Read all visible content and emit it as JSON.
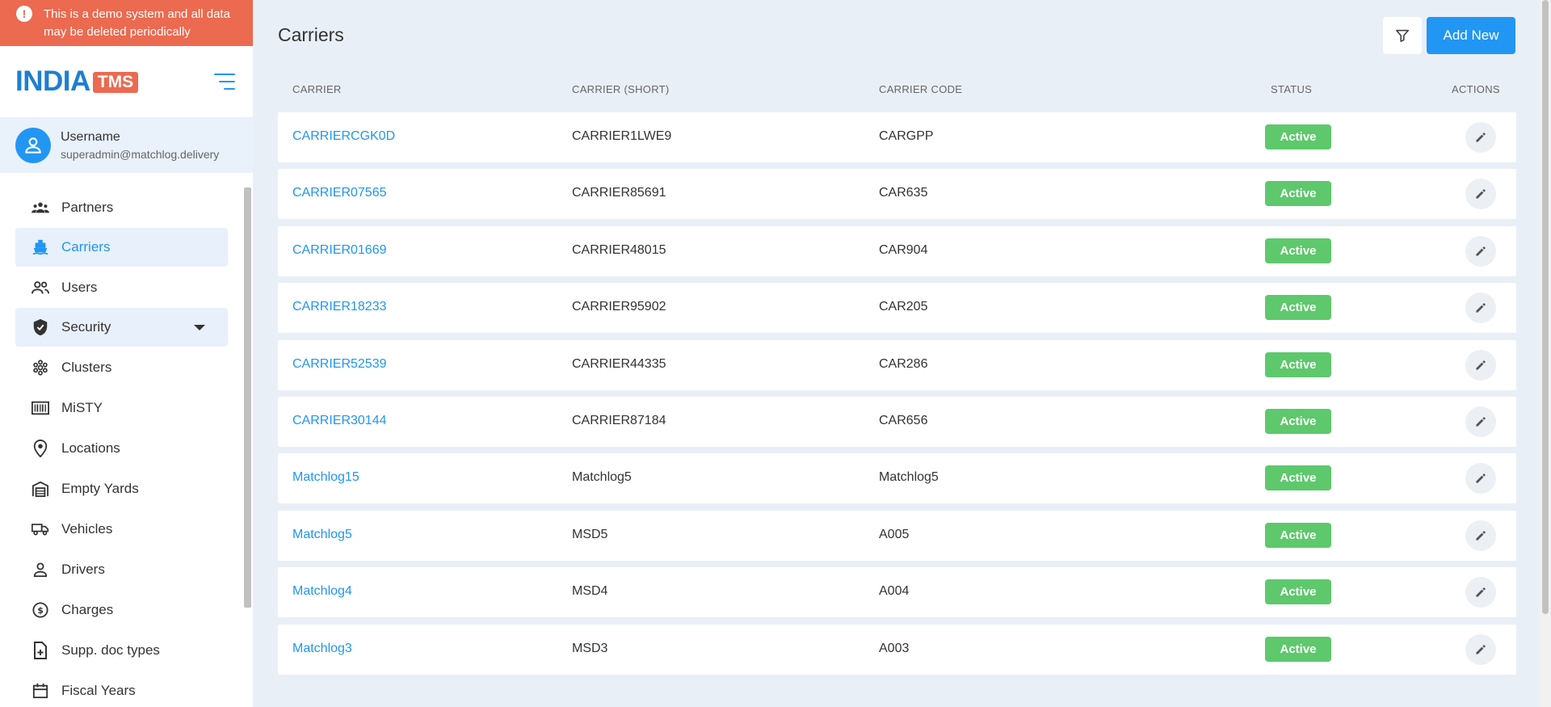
{
  "banner": {
    "text": "This is a demo system and all data may be deleted periodically",
    "icon": "exclamation-icon"
  },
  "brand": {
    "main": "INDIA",
    "badge": "TMS",
    "colors": {
      "blue": "#1e7fd1",
      "orange": "#eb6a50"
    }
  },
  "user": {
    "name": "Username",
    "email": "superadmin@matchlog.delivery"
  },
  "menu": [
    {
      "label": "Partners",
      "icon": "partners-icon"
    },
    {
      "label": "Carriers",
      "icon": "ship-icon",
      "active": true
    },
    {
      "label": "Users",
      "icon": "users-icon"
    },
    {
      "label": "Security",
      "icon": "shield-icon",
      "expandable": true
    },
    {
      "label": "Clusters",
      "icon": "clusters-icon"
    },
    {
      "label": "MiSTY",
      "icon": "barcode-icon"
    },
    {
      "label": "Locations",
      "icon": "location-pin-icon"
    },
    {
      "label": "Empty Yards",
      "icon": "warehouse-icon"
    },
    {
      "label": "Vehicles",
      "icon": "truck-icon"
    },
    {
      "label": "Drivers",
      "icon": "person-icon"
    },
    {
      "label": "Charges",
      "icon": "dollar-icon"
    },
    {
      "label": "Supp. doc types",
      "icon": "doc-add-icon"
    },
    {
      "label": "Fiscal Years",
      "icon": "calendar-icon"
    }
  ],
  "page": {
    "title": "Carriers",
    "add_label": "Add New",
    "columns": [
      "CARRIER",
      "CARRIER (SHORT)",
      "CARRIER CODE",
      "STATUS",
      "ACTIONS"
    ],
    "rows": [
      {
        "carrier": "CARRIERCGK0D",
        "short": "CARRIER1LWE9",
        "code": "CARGPP",
        "status": "Active"
      },
      {
        "carrier": "CARRIER07565",
        "short": "CARRIER85691",
        "code": "CAR635",
        "status": "Active"
      },
      {
        "carrier": "CARRIER01669",
        "short": "CARRIER48015",
        "code": "CAR904",
        "status": "Active"
      },
      {
        "carrier": "CARRIER18233",
        "short": "CARRIER95902",
        "code": "CAR205",
        "status": "Active"
      },
      {
        "carrier": "CARRIER52539",
        "short": "CARRIER44335",
        "code": "CAR286",
        "status": "Active"
      },
      {
        "carrier": "CARRIER30144",
        "short": "CARRIER87184",
        "code": "CAR656",
        "status": "Active"
      },
      {
        "carrier": "Matchlog15",
        "short": "Matchlog5",
        "code": "Matchlog5",
        "status": "Active"
      },
      {
        "carrier": "Matchlog5",
        "short": "MSD5",
        "code": "A005",
        "status": "Active"
      },
      {
        "carrier": "Matchlog4",
        "short": "MSD4",
        "code": "A004",
        "status": "Active"
      },
      {
        "carrier": "Matchlog3",
        "short": "MSD3",
        "code": "A003",
        "status": "Active"
      }
    ]
  },
  "colors": {
    "accent": "#2196f3",
    "status_active": "#5ec86c",
    "banner": "#eb6a50",
    "background": "#e9eff7"
  }
}
